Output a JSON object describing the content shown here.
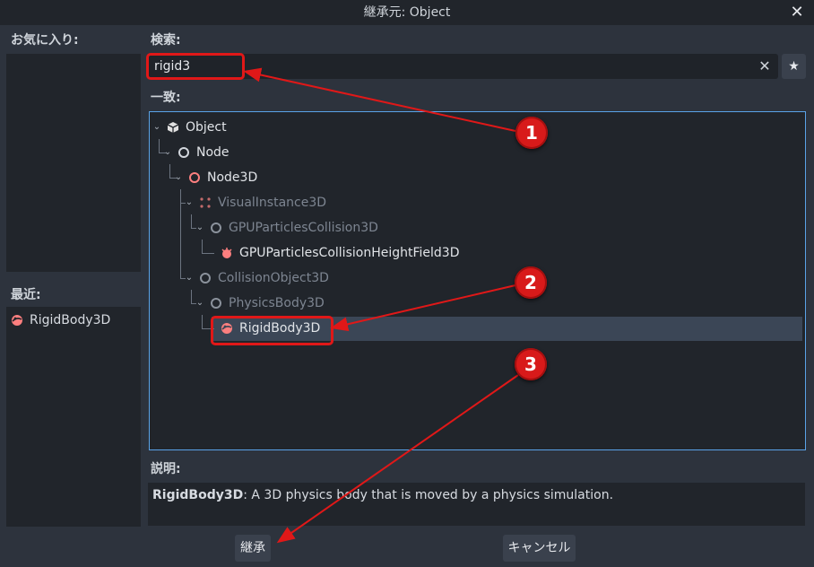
{
  "window": {
    "title": "継承元: Object"
  },
  "favorites": {
    "label": "お気に入り:"
  },
  "recent": {
    "label": "最近:",
    "items": [
      {
        "label": "RigidBody3D",
        "icon": "rigidbody-icon"
      }
    ]
  },
  "search": {
    "label": "検索:",
    "value": "rigid3"
  },
  "matches": {
    "label": "一致:",
    "tree": [
      {
        "label": "Object",
        "depth": 0,
        "icon": "object-icon",
        "dim": false
      },
      {
        "label": "Node",
        "depth": 1,
        "icon": "node-icon",
        "dim": false
      },
      {
        "label": "Node3D",
        "depth": 2,
        "icon": "node3d-icon",
        "dim": false
      },
      {
        "label": "VisualInstance3D",
        "depth": 3,
        "icon": "visualinstance-icon",
        "dim": true
      },
      {
        "label": "GPUParticlesCollision3D",
        "depth": 4,
        "icon": "particles-collision-icon",
        "dim": true
      },
      {
        "label": "GPUParticlesCollisionHeightField3D",
        "depth": 5,
        "icon": "heightfield-icon",
        "dim": false
      },
      {
        "label": "CollisionObject3D",
        "depth": 3,
        "icon": "collision-object-icon",
        "dim": true
      },
      {
        "label": "PhysicsBody3D",
        "depth": 4,
        "icon": "physicsbody-icon",
        "dim": true
      },
      {
        "label": "RigidBody3D",
        "depth": 5,
        "icon": "rigidbody-icon",
        "dim": false,
        "selected": true
      }
    ]
  },
  "description": {
    "label": "説明:",
    "class_name": "RigidBody3D",
    "text": ": A 3D physics body that is moved by a physics simulation."
  },
  "buttons": {
    "inherit": "継承",
    "cancel": "キャンセル"
  },
  "annotations": {
    "one": "1",
    "two": "2",
    "three": "3"
  },
  "colors": {
    "accent": "#5aa3e8",
    "annotation_red": "#e01818",
    "node3d_red": "#fc7f7f"
  }
}
